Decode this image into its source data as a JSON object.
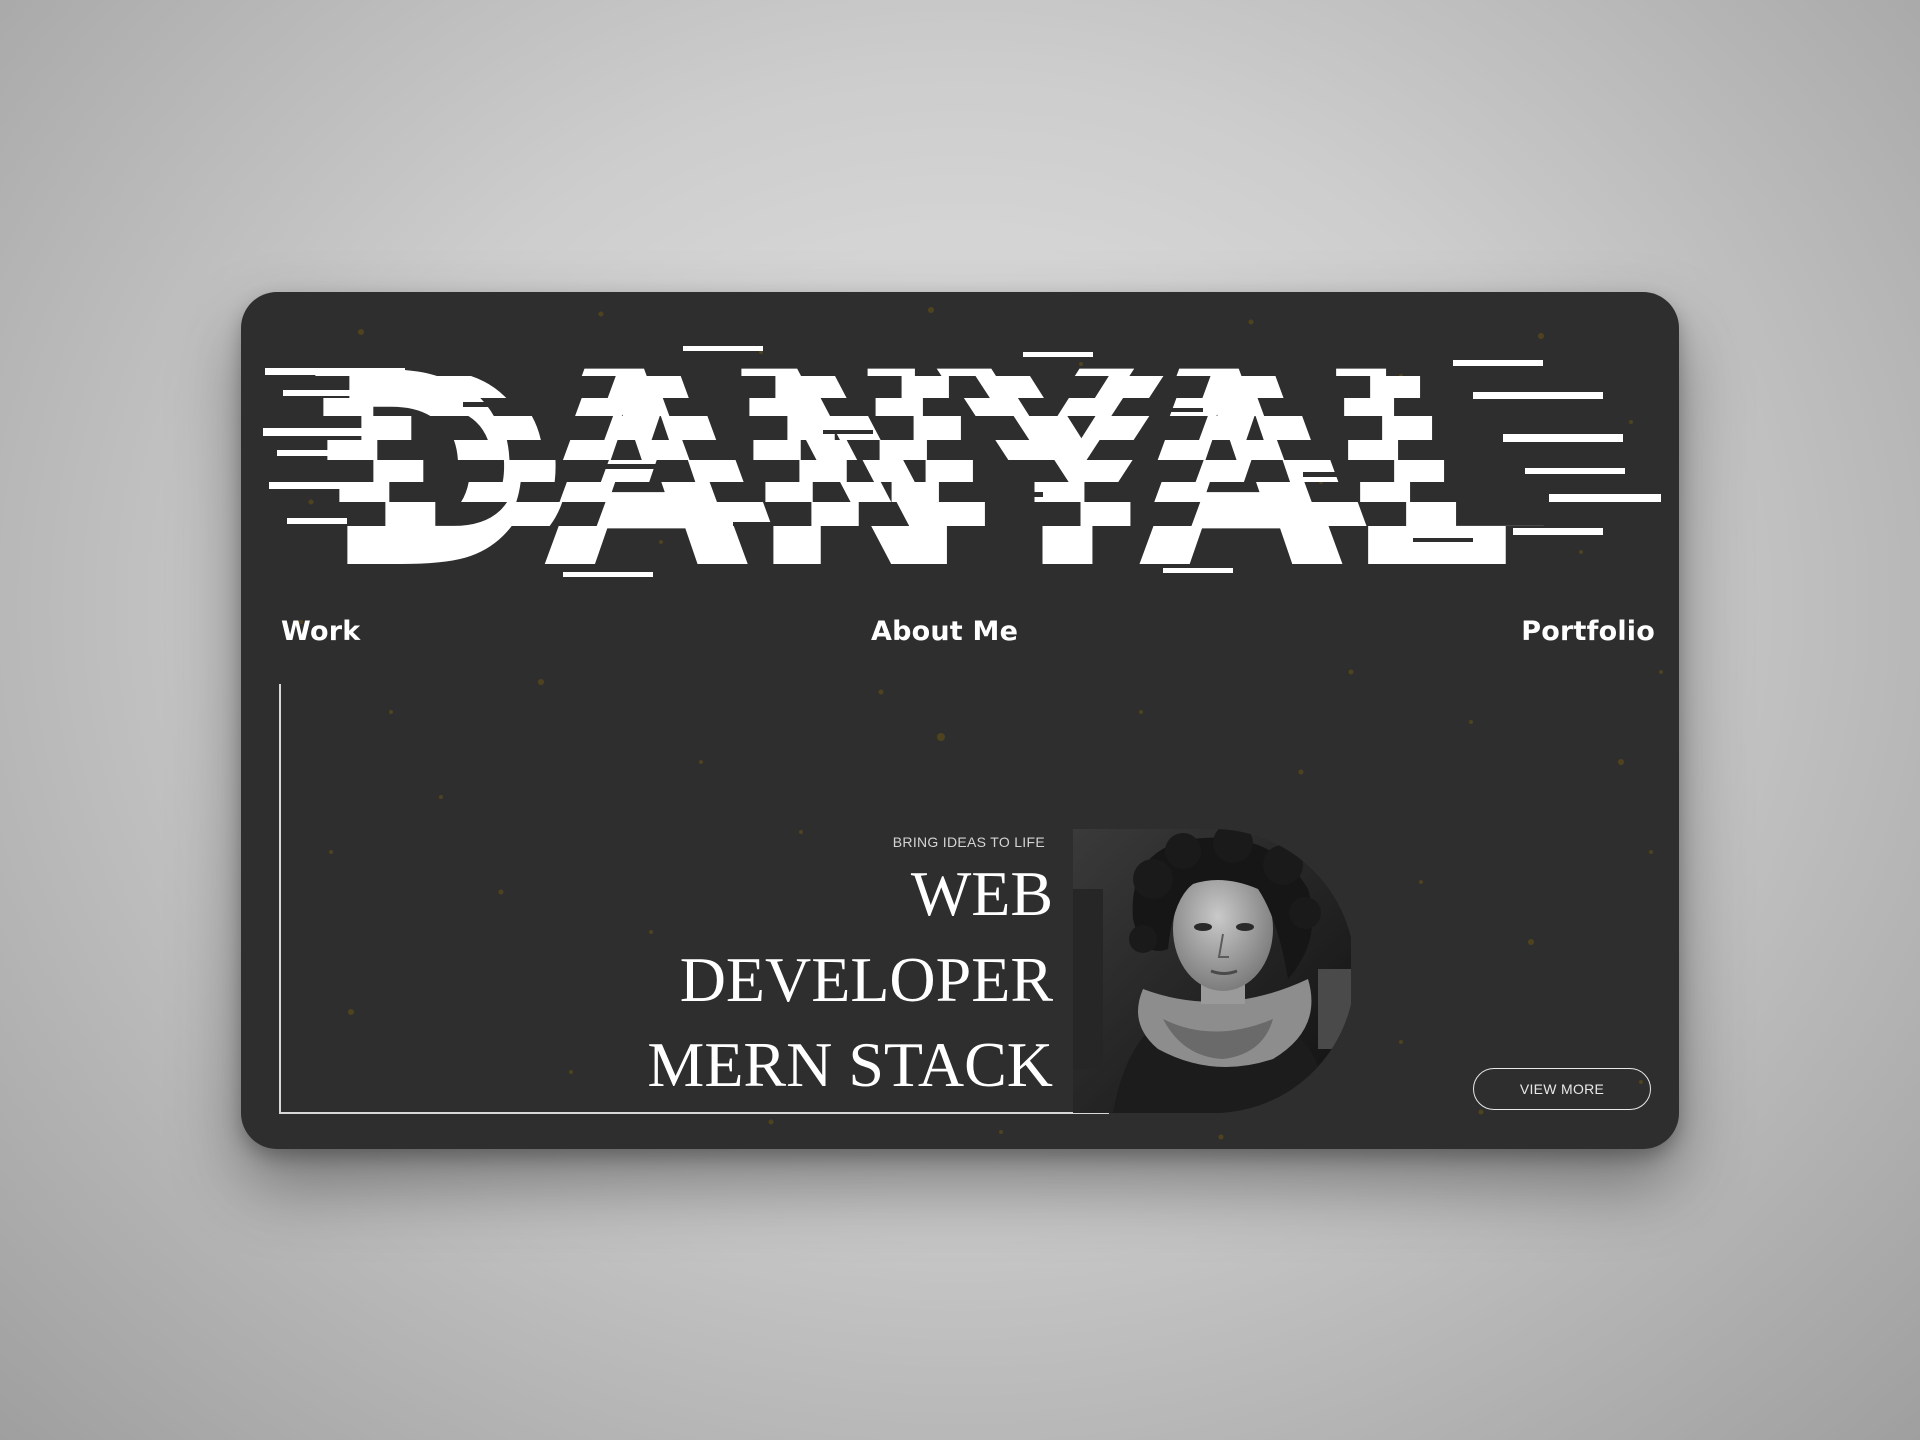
{
  "hero": {
    "logo_text": "DANYAL",
    "tagline": "BRING IDEAS TO LIFE",
    "headline": [
      "WEB",
      "DEVELOPER",
      "MERN STACK"
    ],
    "cta_label": "VIEW MORE"
  },
  "nav": {
    "items": [
      {
        "label": "Work"
      },
      {
        "label": "About Me"
      },
      {
        "label": "Portfolio"
      }
    ]
  },
  "colors": {
    "background": "#c4c4c4",
    "card": "#2e2e2e",
    "text": "#ffffff",
    "speckle": "#6b5512"
  }
}
